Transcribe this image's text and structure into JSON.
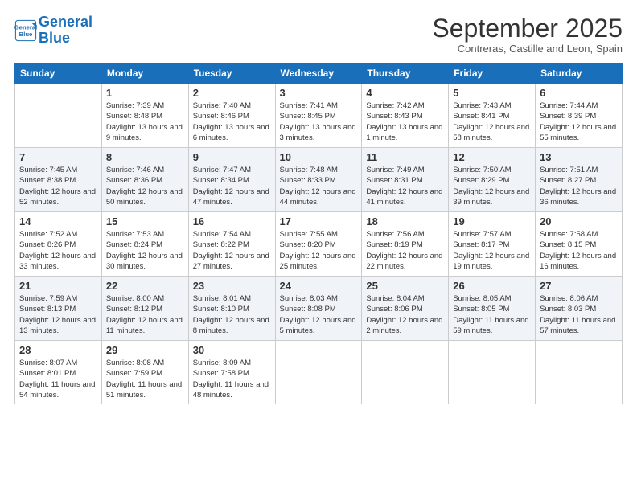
{
  "header": {
    "logo_line1": "General",
    "logo_line2": "Blue",
    "month": "September 2025",
    "location": "Contreras, Castille and Leon, Spain"
  },
  "weekdays": [
    "Sunday",
    "Monday",
    "Tuesday",
    "Wednesday",
    "Thursday",
    "Friday",
    "Saturday"
  ],
  "weeks": [
    [
      {
        "num": "",
        "info": ""
      },
      {
        "num": "1",
        "info": "Sunrise: 7:39 AM\nSunset: 8:48 PM\nDaylight: 13 hours\nand 9 minutes."
      },
      {
        "num": "2",
        "info": "Sunrise: 7:40 AM\nSunset: 8:46 PM\nDaylight: 13 hours\nand 6 minutes."
      },
      {
        "num": "3",
        "info": "Sunrise: 7:41 AM\nSunset: 8:45 PM\nDaylight: 13 hours\nand 3 minutes."
      },
      {
        "num": "4",
        "info": "Sunrise: 7:42 AM\nSunset: 8:43 PM\nDaylight: 13 hours\nand 1 minute."
      },
      {
        "num": "5",
        "info": "Sunrise: 7:43 AM\nSunset: 8:41 PM\nDaylight: 12 hours\nand 58 minutes."
      },
      {
        "num": "6",
        "info": "Sunrise: 7:44 AM\nSunset: 8:39 PM\nDaylight: 12 hours\nand 55 minutes."
      }
    ],
    [
      {
        "num": "7",
        "info": "Sunrise: 7:45 AM\nSunset: 8:38 PM\nDaylight: 12 hours\nand 52 minutes."
      },
      {
        "num": "8",
        "info": "Sunrise: 7:46 AM\nSunset: 8:36 PM\nDaylight: 12 hours\nand 50 minutes."
      },
      {
        "num": "9",
        "info": "Sunrise: 7:47 AM\nSunset: 8:34 PM\nDaylight: 12 hours\nand 47 minutes."
      },
      {
        "num": "10",
        "info": "Sunrise: 7:48 AM\nSunset: 8:33 PM\nDaylight: 12 hours\nand 44 minutes."
      },
      {
        "num": "11",
        "info": "Sunrise: 7:49 AM\nSunset: 8:31 PM\nDaylight: 12 hours\nand 41 minutes."
      },
      {
        "num": "12",
        "info": "Sunrise: 7:50 AM\nSunset: 8:29 PM\nDaylight: 12 hours\nand 39 minutes."
      },
      {
        "num": "13",
        "info": "Sunrise: 7:51 AM\nSunset: 8:27 PM\nDaylight: 12 hours\nand 36 minutes."
      }
    ],
    [
      {
        "num": "14",
        "info": "Sunrise: 7:52 AM\nSunset: 8:26 PM\nDaylight: 12 hours\nand 33 minutes."
      },
      {
        "num": "15",
        "info": "Sunrise: 7:53 AM\nSunset: 8:24 PM\nDaylight: 12 hours\nand 30 minutes."
      },
      {
        "num": "16",
        "info": "Sunrise: 7:54 AM\nSunset: 8:22 PM\nDaylight: 12 hours\nand 27 minutes."
      },
      {
        "num": "17",
        "info": "Sunrise: 7:55 AM\nSunset: 8:20 PM\nDaylight: 12 hours\nand 25 minutes."
      },
      {
        "num": "18",
        "info": "Sunrise: 7:56 AM\nSunset: 8:19 PM\nDaylight: 12 hours\nand 22 minutes."
      },
      {
        "num": "19",
        "info": "Sunrise: 7:57 AM\nSunset: 8:17 PM\nDaylight: 12 hours\nand 19 minutes."
      },
      {
        "num": "20",
        "info": "Sunrise: 7:58 AM\nSunset: 8:15 PM\nDaylight: 12 hours\nand 16 minutes."
      }
    ],
    [
      {
        "num": "21",
        "info": "Sunrise: 7:59 AM\nSunset: 8:13 PM\nDaylight: 12 hours\nand 13 minutes."
      },
      {
        "num": "22",
        "info": "Sunrise: 8:00 AM\nSunset: 8:12 PM\nDaylight: 12 hours\nand 11 minutes."
      },
      {
        "num": "23",
        "info": "Sunrise: 8:01 AM\nSunset: 8:10 PM\nDaylight: 12 hours\nand 8 minutes."
      },
      {
        "num": "24",
        "info": "Sunrise: 8:03 AM\nSunset: 8:08 PM\nDaylight: 12 hours\nand 5 minutes."
      },
      {
        "num": "25",
        "info": "Sunrise: 8:04 AM\nSunset: 8:06 PM\nDaylight: 12 hours\nand 2 minutes."
      },
      {
        "num": "26",
        "info": "Sunrise: 8:05 AM\nSunset: 8:05 PM\nDaylight: 11 hours\nand 59 minutes."
      },
      {
        "num": "27",
        "info": "Sunrise: 8:06 AM\nSunset: 8:03 PM\nDaylight: 11 hours\nand 57 minutes."
      }
    ],
    [
      {
        "num": "28",
        "info": "Sunrise: 8:07 AM\nSunset: 8:01 PM\nDaylight: 11 hours\nand 54 minutes."
      },
      {
        "num": "29",
        "info": "Sunrise: 8:08 AM\nSunset: 7:59 PM\nDaylight: 11 hours\nand 51 minutes."
      },
      {
        "num": "30",
        "info": "Sunrise: 8:09 AM\nSunset: 7:58 PM\nDaylight: 11 hours\nand 48 minutes."
      },
      {
        "num": "",
        "info": ""
      },
      {
        "num": "",
        "info": ""
      },
      {
        "num": "",
        "info": ""
      },
      {
        "num": "",
        "info": ""
      }
    ]
  ]
}
